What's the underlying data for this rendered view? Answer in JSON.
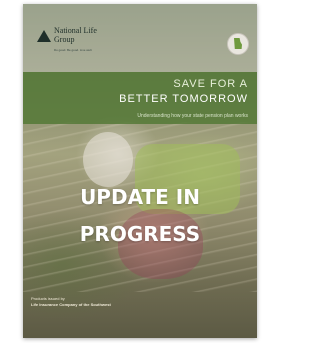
{
  "logo": {
    "name_line1": "National Life",
    "name_line2": "Group",
    "tagline": "Do good. Be good. Live well."
  },
  "headline": {
    "line1": "SAVE FOR A",
    "line2": "BETTER TOMORROW",
    "subtitle": "Understanding how your state pension plan works"
  },
  "overlay": {
    "line1": "UPDATE IN",
    "line2": "PROGRESS"
  },
  "footer": {
    "issued_by": "Products issued by",
    "company": "Life Insurance Company of the Southwest"
  },
  "colors": {
    "green_band": "#527834",
    "logo_dark": "#1f2f2a",
    "state_green": "#6f9a3e"
  },
  "icons": {
    "logo": "triangle-logo-icon",
    "state_badge": "state-map-icon"
  }
}
